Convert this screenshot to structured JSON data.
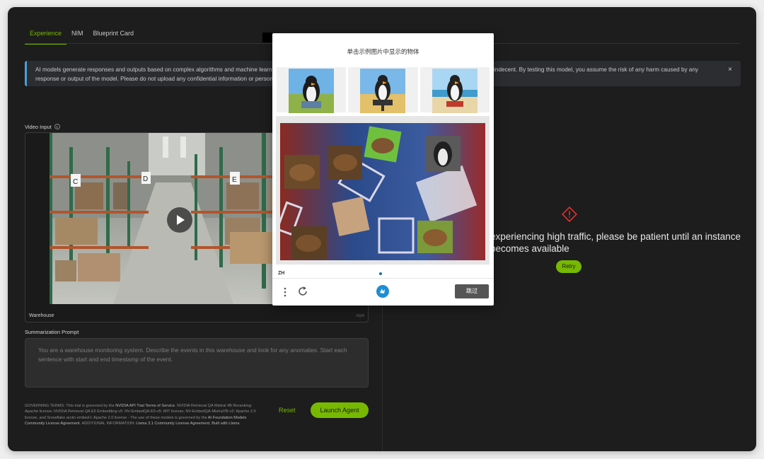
{
  "tabs": [
    {
      "label": "Experience",
      "active": true
    },
    {
      "label": "NIM",
      "active": false
    },
    {
      "label": "Blueprint Card",
      "active": false
    }
  ],
  "banner": {
    "text": "AI models generate responses and outputs based on complex algorithms and machine learning techniques, and those responses or outputs may be inaccurate, harmful, biased or indecent. By testing this model, you assume the risk of any harm caused by any response or output of the model. Please do not upload any confidential information or personal data unless expressly permitted. Your use is logged for security purposes.",
    "close": "×"
  },
  "video_input": {
    "label": "Video Input",
    "filename": "Warehouse",
    "extension": "mp4"
  },
  "summarization": {
    "label": "Summarization Prompt",
    "text": "You are a warehouse monitoring system. Describe the events in this warehouse and look for any anomalies. Start each sentence with start and end timestamp of the event."
  },
  "terms": {
    "t1": "GOVERNING TERMS: This trial is governed by the ",
    "l1": "NVIDIA API Trial Terms of Service",
    "t2": ". NVIDIA Retrieval QA Mistral 4B Reranking: Apache license; NVIDIA Retrieval QA E5 Embedding v5: NV-EmbedQA-E5-v5: MIT license; NV-EmbedQA-Mistral7B-v2: Apache 2.0 license, and Snowflake arctic-embed-l: Apache 2.0 license - The use of these models is governed by the ",
    "l2": "AI Foundation Models Community License Agreement",
    "t3": ". ADDITIONAL INFORMATION: ",
    "l3": "Llama 3.1 Community License Agreement",
    "t4": ", ",
    "l4": "Built with Llama"
  },
  "actions": {
    "reset": "Reset",
    "launch": "Launch Agent"
  },
  "status": {
    "message": "experiencing high traffic, please be patient until an instance becomes available",
    "retry": "Retry"
  },
  "captcha": {
    "title": "单击示例图片中显示的物体",
    "lang": "ZH",
    "skip": "跳过"
  },
  "colors": {
    "accent": "#76b900",
    "info_bar": "#4a9fd8",
    "warning": "#e0342c"
  }
}
